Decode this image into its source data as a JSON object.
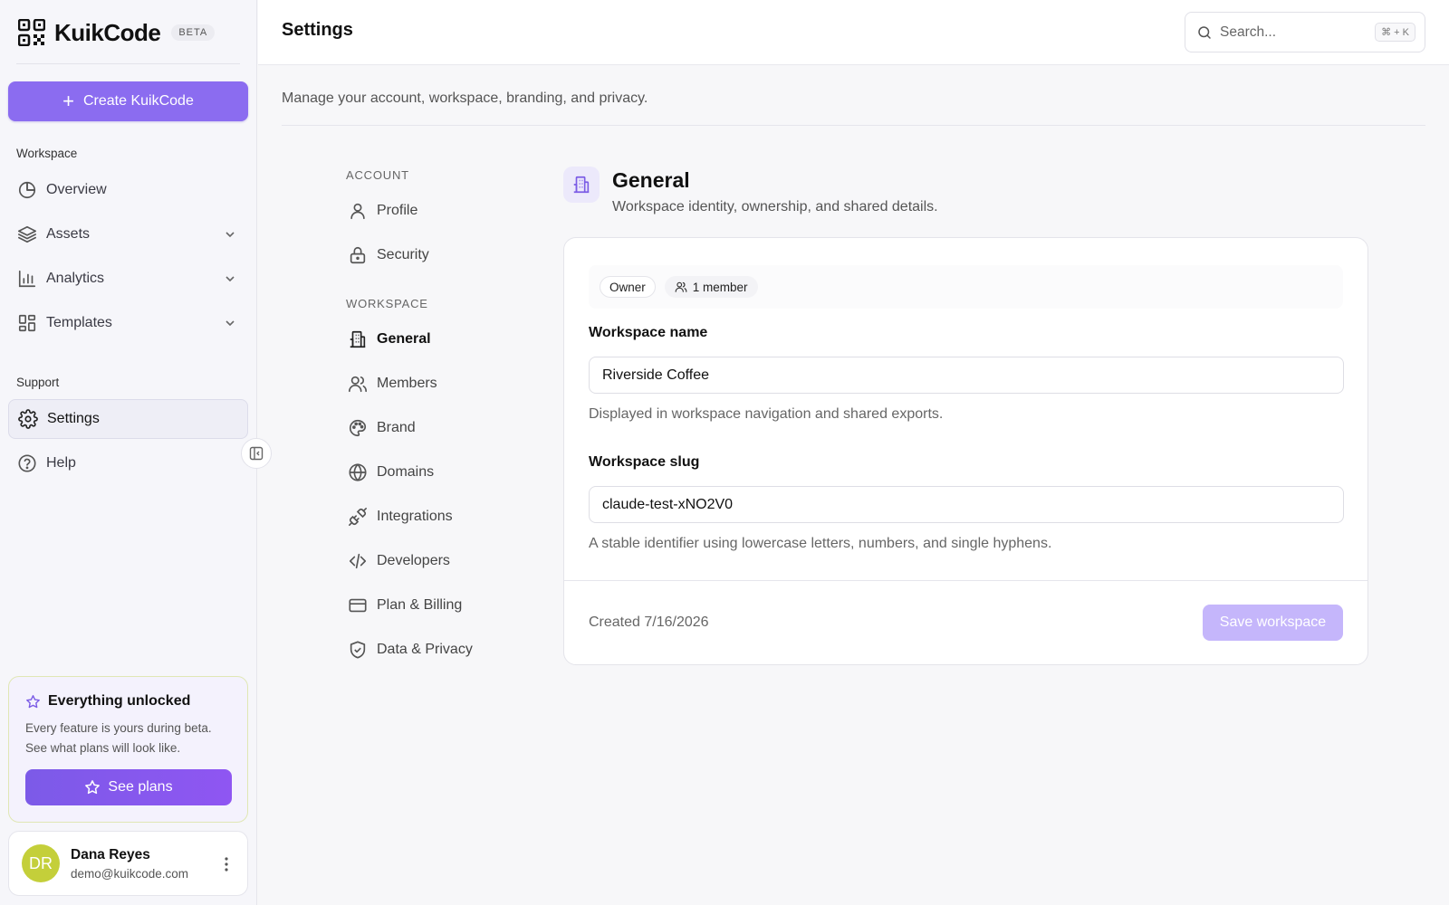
{
  "brand": {
    "name": "KuikCode",
    "badge": "BETA"
  },
  "sidebar": {
    "create_label": "Create KuikCode",
    "workspace_label": "Workspace",
    "items": [
      {
        "label": "Overview",
        "icon": "pie-chart-icon"
      },
      {
        "label": "Assets",
        "icon": "layers-icon"
      },
      {
        "label": "Analytics",
        "icon": "bar-chart-icon"
      },
      {
        "label": "Templates",
        "icon": "layout-icon"
      }
    ],
    "support_label": "Support",
    "support_items": [
      {
        "label": "Settings",
        "icon": "gear-icon",
        "active": true
      },
      {
        "label": "Help",
        "icon": "help-circle-icon"
      }
    ],
    "promo": {
      "title": "Everything unlocked",
      "text": "Every feature is yours during beta. See what plans will look like.",
      "button": "See plans"
    },
    "user": {
      "initials": "DR",
      "name": "Dana Reyes",
      "email": "demo@kuikcode.com"
    }
  },
  "header": {
    "title": "Settings",
    "search_placeholder": "Search...",
    "search_shortcut": "⌘ + K"
  },
  "subtitle": "Manage your account, workspace, branding, and privacy.",
  "settings_nav": {
    "account_label": "ACCOUNT",
    "account_items": [
      {
        "label": "Profile",
        "icon": "user-icon"
      },
      {
        "label": "Security",
        "icon": "lock-icon"
      }
    ],
    "workspace_label": "WORKSPACE",
    "workspace_items": [
      {
        "label": "General",
        "icon": "building-icon",
        "active": true
      },
      {
        "label": "Members",
        "icon": "users-icon"
      },
      {
        "label": "Brand",
        "icon": "palette-icon"
      },
      {
        "label": "Domains",
        "icon": "globe-icon"
      },
      {
        "label": "Integrations",
        "icon": "plug-icon"
      },
      {
        "label": "Developers",
        "icon": "code-icon"
      },
      {
        "label": "Plan & Billing",
        "icon": "credit-card-icon"
      },
      {
        "label": "Data & Privacy",
        "icon": "shield-check-icon"
      }
    ]
  },
  "general": {
    "title": "General",
    "description": "Workspace identity, ownership, and shared details.",
    "role_badge": "Owner",
    "members_badge": "1 member",
    "name_label": "Workspace name",
    "name_value": "Riverside Coffee",
    "name_help": "Displayed in workspace navigation and shared exports.",
    "slug_label": "Workspace slug",
    "slug_value": "claude-test-xNO2V0",
    "slug_help": "A stable identifier using lowercase letters, numbers, and single hyphens.",
    "created": "Created 7/16/2026",
    "save_label": "Save workspace"
  },
  "colors": {
    "accent": "#8b6cf0",
    "save_disabled": "#c5b6fb",
    "avatar": "#c4cf3a"
  }
}
